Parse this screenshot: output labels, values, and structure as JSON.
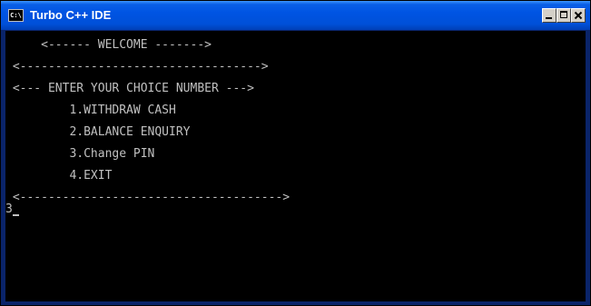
{
  "window": {
    "title": "Turbo C++ IDE",
    "app_icon_text": "C:\\",
    "icon": "console-app-icon"
  },
  "titlebar_buttons": {
    "minimize_icon": "minimize-icon",
    "maximize_icon": "maximize-icon",
    "close_icon": "close-icon"
  },
  "console": {
    "welcome": "     <------ WELCOME ------->",
    "separator1": " <---------------------------------->",
    "prompt": " <--- ENTER YOUR CHOICE NUMBER --->",
    "menu": [
      "         1.WITHDRAW CASH",
      "         2.BALANCE ENQUIRY",
      "         3.Change PIN",
      "         4.EXIT"
    ],
    "separator2": " <------------------------------------->",
    "input_value": "3"
  },
  "colors": {
    "titlebar": "#0054e3",
    "console_background": "#000000",
    "console_text": "#c0c0c0"
  }
}
